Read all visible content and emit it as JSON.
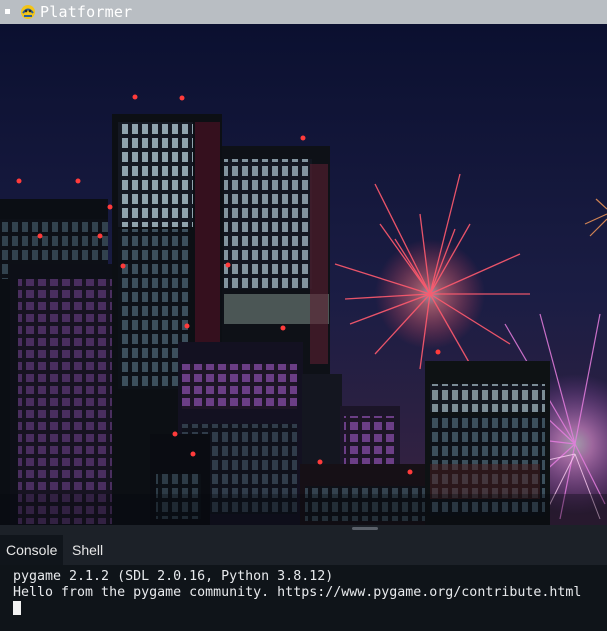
{
  "window": {
    "title": "Platformer"
  },
  "scene": {
    "description_icon": "city-fireworks-background",
    "colors": {
      "sky_top": "#0c1130",
      "sky_bottom": "#2a1d3e",
      "firework_red": "#ff4f63",
      "firework_pink": "#f06dd7",
      "firework_violet": "#9a5cff"
    }
  },
  "panel": {
    "tabs": [
      {
        "label": "Console",
        "active": true
      },
      {
        "label": "Shell",
        "active": false
      }
    ]
  },
  "console": {
    "lines": [
      "pygame 2.1.2 (SDL 2.0.16, Python 3.8.12)",
      "Hello from the pygame community. https://www.pygame.org/contribute.html"
    ]
  }
}
